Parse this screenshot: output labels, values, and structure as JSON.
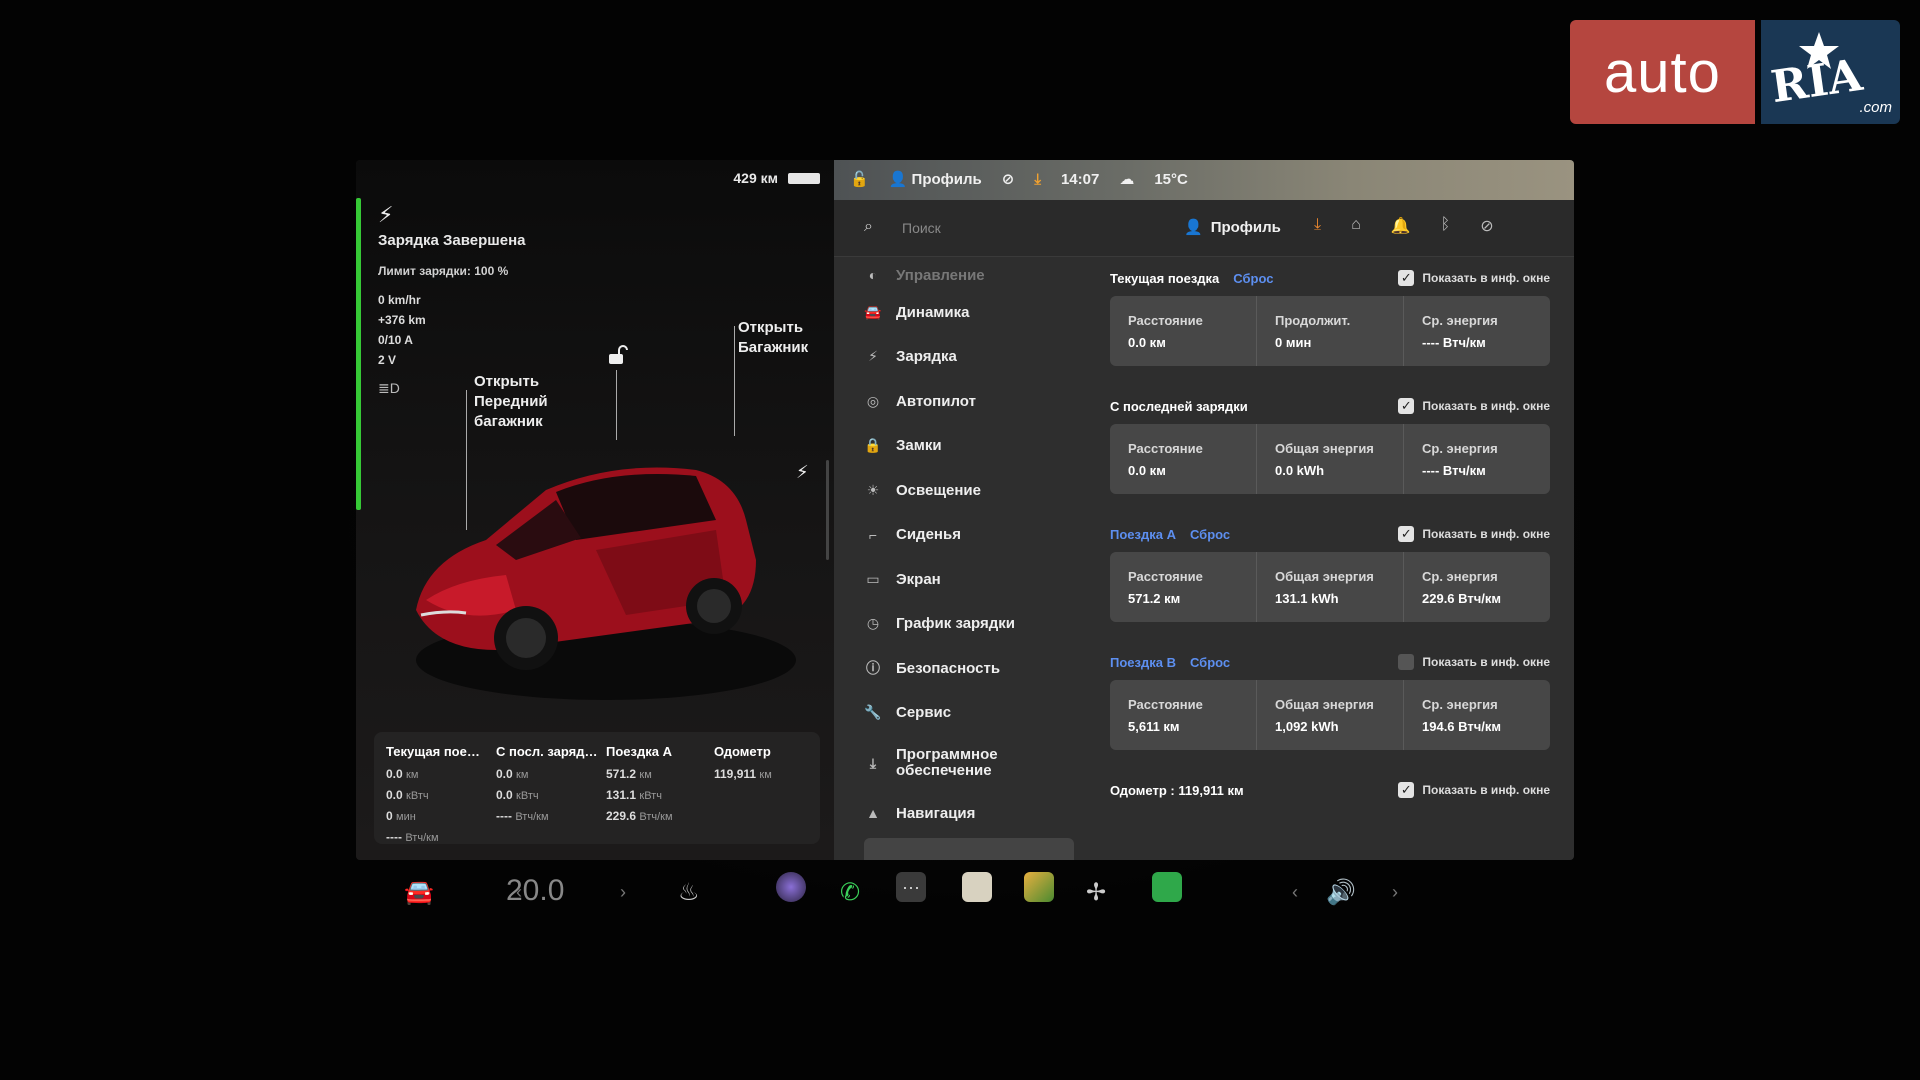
{
  "watermark": {
    "auto": "auto",
    "ria": "RIA",
    "com": ".com"
  },
  "left": {
    "range": "429 км",
    "charge_title": "Зарядка Завершена",
    "charge_limit": "Лимит зарядки: 100 %",
    "stats": [
      "0 km/hr",
      "+376 km",
      "0/10 A",
      "2 V"
    ],
    "label_front": "Открыть Передний багажник",
    "label_trunk": "Открыть Багажник",
    "trip_card": [
      {
        "head": "Текущая пое…",
        "rows": [
          [
            "0.0",
            "км"
          ],
          [
            "0.0",
            "кВтч"
          ],
          [
            "0",
            "мин"
          ],
          [
            "----",
            "Втч/км"
          ]
        ]
      },
      {
        "head": "С посл. заряд…",
        "rows": [
          [
            "0.0",
            "км"
          ],
          [
            "0.0",
            "кВтч"
          ],
          [
            "----",
            "Втч/км"
          ]
        ]
      },
      {
        "head": "Поездка A",
        "rows": [
          [
            "571.2",
            "км"
          ],
          [
            "131.1",
            "кВтч"
          ],
          [
            "229.6",
            "Втч/км"
          ]
        ]
      },
      {
        "head": "Одометр",
        "rows": [
          [
            "119,911",
            "км"
          ]
        ]
      }
    ]
  },
  "statusbar": {
    "profile": "Профиль",
    "time": "14:07",
    "temp": "15°C"
  },
  "search": {
    "placeholder": "Поиск",
    "profile": "Профиль"
  },
  "menu": [
    {
      "icon": "toggle-icon",
      "label": "Управление"
    },
    {
      "icon": "car-icon",
      "label": "Динамика"
    },
    {
      "icon": "bolt-icon",
      "label": "Зарядка"
    },
    {
      "icon": "steering-wheel-icon",
      "label": "Автопилот"
    },
    {
      "icon": "lock-icon",
      "label": "Замки"
    },
    {
      "icon": "sun-icon",
      "label": "Освещение"
    },
    {
      "icon": "seat-icon",
      "label": "Сиденья"
    },
    {
      "icon": "screen-icon",
      "label": "Экран"
    },
    {
      "icon": "clock-icon",
      "label": "График зарядки"
    },
    {
      "icon": "alert-icon",
      "label": "Безопасность"
    },
    {
      "icon": "wrench-icon",
      "label": "Сервис"
    },
    {
      "icon": "download-icon",
      "label": "Программное обеспечение"
    },
    {
      "icon": "navigation-icon",
      "label": "Навигация"
    }
  ],
  "sections": [
    {
      "title": "Текущая поездка",
      "title_blue": false,
      "reset": "Сброс",
      "checked": true,
      "check_label": "Показать в инф. окне",
      "stats": [
        {
          "k": "Расстояние",
          "v": "0.0 км"
        },
        {
          "k": "Продолжит.",
          "v": "0 мин"
        },
        {
          "k": "Ср. энергия",
          "v": "---- Втч/км"
        }
      ]
    },
    {
      "title": "С последней зарядки",
      "title_blue": false,
      "reset": "",
      "checked": true,
      "check_label": "Показать в инф. окне",
      "stats": [
        {
          "k": "Расстояние",
          "v": "0.0 км"
        },
        {
          "k": "Общая энергия",
          "v": "0.0 kWh"
        },
        {
          "k": "Ср. энергия",
          "v": "---- Втч/км"
        }
      ]
    },
    {
      "title": "Поездка A",
      "title_blue": true,
      "reset": "Сброс",
      "checked": true,
      "check_label": "Показать в инф. окне",
      "stats": [
        {
          "k": "Расстояние",
          "v": "571.2 км"
        },
        {
          "k": "Общая энергия",
          "v": "131.1 kWh"
        },
        {
          "k": "Ср. энергия",
          "v": "229.6 Втч/км"
        }
      ]
    },
    {
      "title": "Поездка B",
      "title_blue": true,
      "reset": "Сброс",
      "checked": false,
      "check_label": "Показать в инф. окне",
      "stats": [
        {
          "k": "Расстояние",
          "v": "5,611 км"
        },
        {
          "k": "Общая энергия",
          "v": "1,092 kWh"
        },
        {
          "k": "Ср. энергия",
          "v": "194.6 Втч/км"
        }
      ]
    }
  ],
  "odometer": {
    "label": "Одометр",
    "value": "119,911 км",
    "checked": true,
    "check_label": "Показать в инф. окне"
  },
  "taskbar": {
    "temperature": "20.0"
  },
  "colors": {
    "charge": "#36c936",
    "accent_blue": "#5d8ff0",
    "download": "#f08a30",
    "car_red": "#b0101e"
  }
}
